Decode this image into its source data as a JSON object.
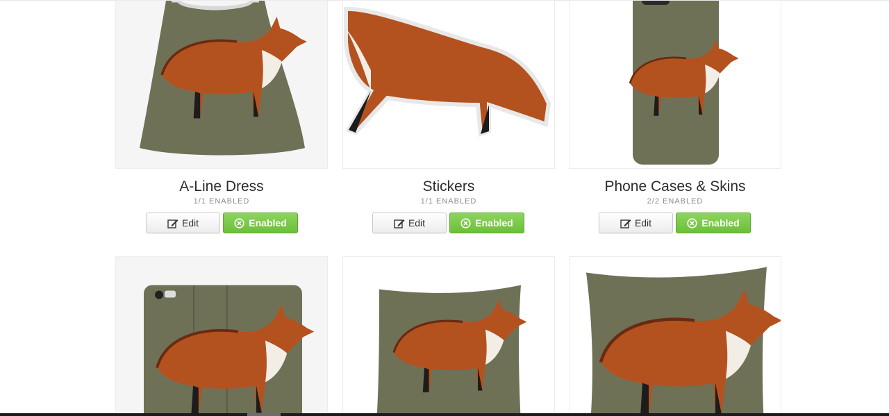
{
  "products": [
    {
      "title": "A-Line Dress",
      "status": "1/1 ENABLED",
      "edit_label": "Edit",
      "enabled_label": "Enabled"
    },
    {
      "title": "Stickers",
      "status": "1/1 ENABLED",
      "edit_label": "Edit",
      "enabled_label": "Enabled"
    },
    {
      "title": "Phone Cases & Skins",
      "status": "2/2 ENABLED",
      "edit_label": "Edit",
      "enabled_label": "Enabled"
    },
    {
      "title": "",
      "status": "",
      "edit_label": "",
      "enabled_label": ""
    },
    {
      "title": "",
      "status": "",
      "edit_label": "",
      "enabled_label": ""
    },
    {
      "title": "",
      "status": "",
      "edit_label": "",
      "enabled_label": ""
    }
  ],
  "colors": {
    "enabled_green": "#7cc94c",
    "fox_orange": "#b8531f",
    "background_olive": "#6f7157"
  }
}
